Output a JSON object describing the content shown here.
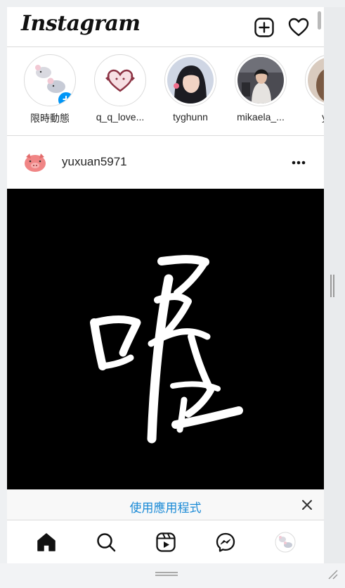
{
  "header": {
    "logo": "Instagram",
    "new_post_icon": "plus-square-icon",
    "activity_icon": "heart-icon"
  },
  "stories": [
    {
      "name": "限時動態",
      "is_own": true
    },
    {
      "name": "q_q_love..."
    },
    {
      "name": "tyghunn"
    },
    {
      "name": "mikaela_..."
    },
    {
      "name": "yiha"
    }
  ],
  "post": {
    "username": "yuxuan5971",
    "more_icon": "more-dots-icon",
    "image_text": "喔"
  },
  "banner": {
    "link_text": "使用應用程式",
    "close_icon": "close-icon"
  },
  "bottom_nav": {
    "items": [
      "home-icon",
      "search-icon",
      "reels-icon",
      "messenger-icon",
      "profile-avatar"
    ]
  },
  "colors": {
    "accent_blue": "#0095f6",
    "link_blue": "#1a8ad6",
    "border": "#dbdbdb"
  }
}
